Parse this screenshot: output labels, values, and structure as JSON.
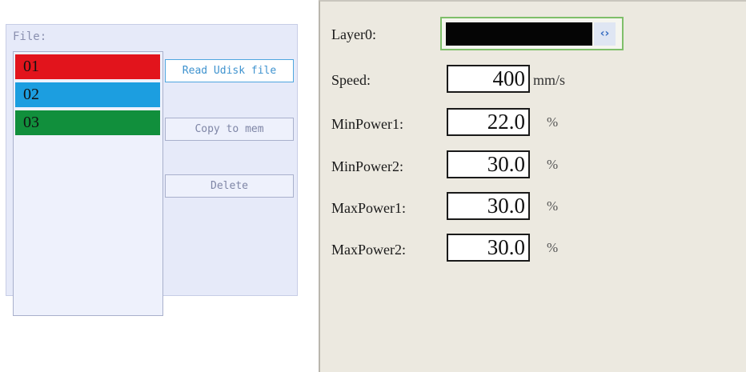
{
  "file_dialog": {
    "label": "File:",
    "files": [
      {
        "name": "01",
        "color": "#e2141c"
      },
      {
        "name": "02",
        "color": "#1c9ee0"
      },
      {
        "name": "03",
        "color": "#118f3c"
      }
    ],
    "buttons": {
      "read": "Read Udisk file",
      "copy": "Copy to mem",
      "delete": "Delete"
    }
  },
  "layer_params": {
    "layer_label": "Layer0:",
    "layer_color": "#050505",
    "layer_arrows": "‹›",
    "speed": {
      "label": "Speed:",
      "value": "400",
      "unit": "mm/s"
    },
    "min_power1": {
      "label": "MinPower1:",
      "value": "22.0",
      "unit": "%"
    },
    "min_power2": {
      "label": "MinPower2:",
      "value": "30.0",
      "unit": "%"
    },
    "max_power1": {
      "label": "MaxPower1:",
      "value": "30.0",
      "unit": "%"
    },
    "max_power2": {
      "label": "MaxPower2:",
      "value": "30.0",
      "unit": "%"
    }
  }
}
